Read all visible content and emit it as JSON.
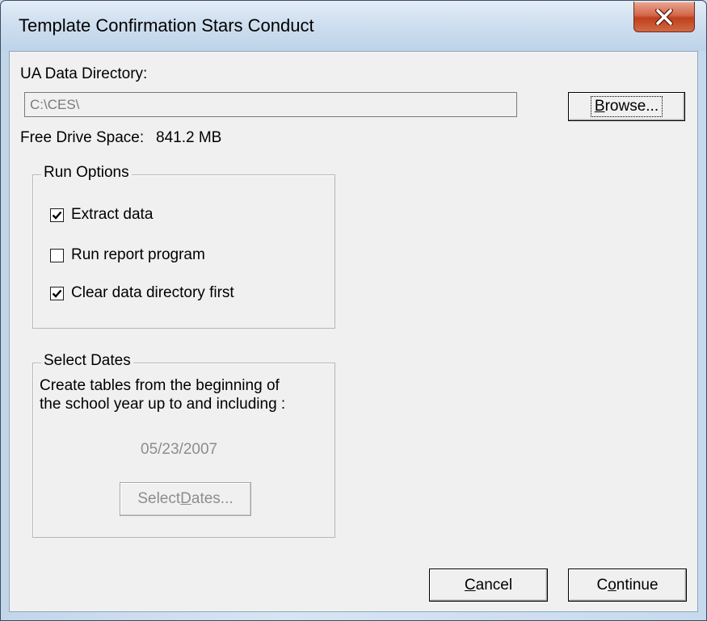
{
  "window": {
    "title": "Template Confirmation Stars Conduct",
    "close_glyph": "X"
  },
  "data_directory": {
    "label": "UA Data Directory:",
    "value": "C:\\CES\\",
    "browse_label_underlined": "B",
    "browse_label_rest": "rowse...",
    "free_space_label": "Free Drive Space:",
    "free_space_value": "841.2 MB"
  },
  "run_options": {
    "title": "Run Options",
    "items": [
      {
        "label": "Extract data",
        "checked": true
      },
      {
        "label": "Run report program",
        "checked": false
      },
      {
        "label": "Clear data directory first",
        "checked": true
      }
    ]
  },
  "select_dates": {
    "title": "Select Dates",
    "line1": "Create tables from the beginning of",
    "line2": "the school year up to and including :",
    "date": "05/23/2007",
    "button_prefix": "Select ",
    "button_underlined": "D",
    "button_rest": "ates..."
  },
  "footer": {
    "cancel_underlined": "C",
    "cancel_rest": "ancel",
    "continue_prefix": "C",
    "continue_underlined": "o",
    "continue_rest": "ntinue"
  }
}
